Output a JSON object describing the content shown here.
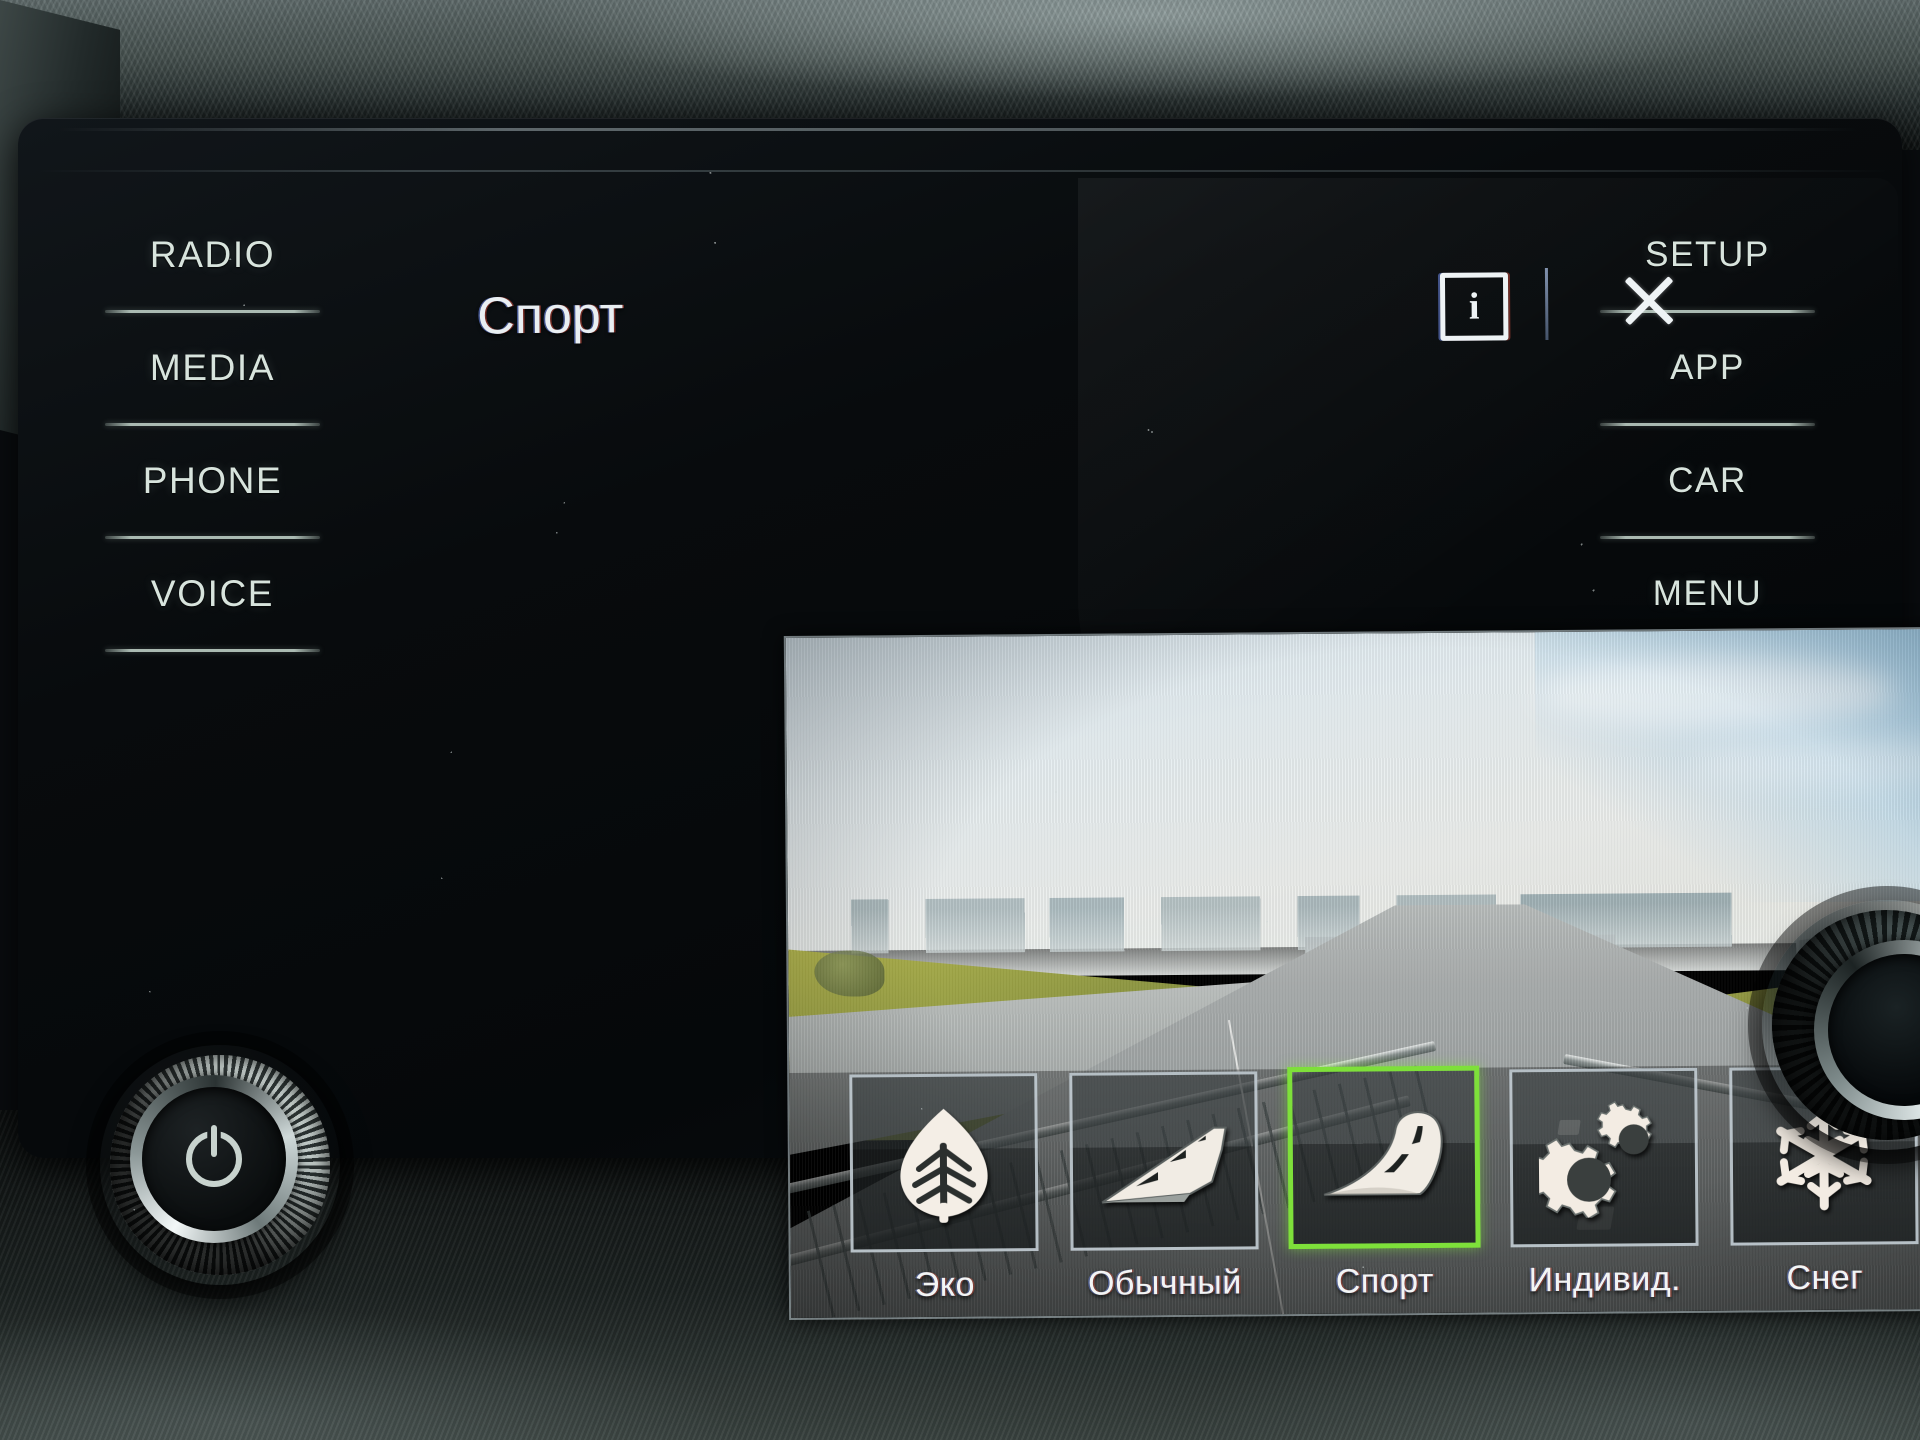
{
  "header": {
    "title": "Спорт",
    "info_icon": "info-icon",
    "info_letter": "i",
    "close_icon": "close-icon"
  },
  "left_keys": [
    {
      "label": "RADIO"
    },
    {
      "label": "MEDIA"
    },
    {
      "label": "PHONE"
    },
    {
      "label": "VOICE"
    }
  ],
  "right_keys": [
    {
      "label": "SETUP"
    },
    {
      "label": "APP"
    },
    {
      "label": "CAR"
    },
    {
      "label": "MENU"
    }
  ],
  "drive_modes": [
    {
      "label": "Эко",
      "icon": "leaf-icon",
      "selected": false
    },
    {
      "label": "Обычный",
      "icon": "straight-road-icon",
      "selected": false
    },
    {
      "label": "Спорт",
      "icon": "curved-road-icon",
      "selected": true
    },
    {
      "label": "Индивид.",
      "icon": "gears-icon",
      "selected": false
    },
    {
      "label": "Снег",
      "icon": "snowflake-icon",
      "selected": false
    }
  ],
  "knobs": {
    "left": {
      "name": "power-volume-knob",
      "glyph": "power-icon"
    },
    "right": {
      "name": "tune-knob"
    }
  },
  "colors": {
    "selection_green": "#7ee03a",
    "key_text": "#d8e4dd",
    "screen_text": "#eef3f5",
    "bezel_black": "#06090b"
  }
}
